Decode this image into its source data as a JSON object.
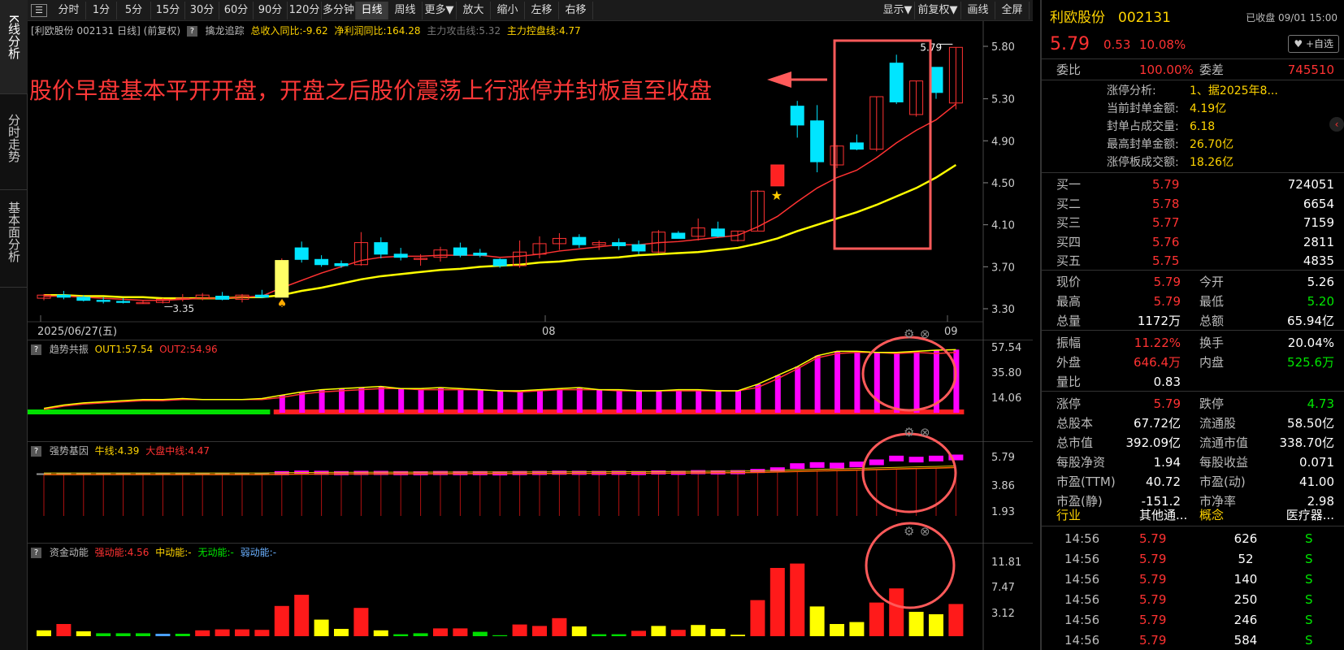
{
  "toolbar": {
    "items": [
      "分时",
      "1分",
      "5分",
      "15分",
      "30分",
      "60分",
      "90分",
      "120分",
      "多分钟",
      "日线",
      "周线",
      "更多▼",
      "放大",
      "缩小",
      "左移",
      "右移",
      "显示▼",
      "前复权▼",
      "画线",
      "全屏"
    ]
  },
  "left_tabs": [
    {
      "label": "K线分析"
    },
    {
      "label": "分时走势"
    },
    {
      "label": "基本面分析"
    }
  ],
  "kline": {
    "header": {
      "stock": "[利欧股份 002131 日线]",
      "fq": "(前复权)",
      "indicator": "擒龙追踪",
      "rev": "总收入同比:-9.62",
      "profit": "净利润同比:164.28",
      "attack": "主力攻击线:5.32",
      "control": "主力控盘线:4.77"
    },
    "y_ticks": [
      "5.80",
      "5.30",
      "4.90",
      "4.50",
      "4.10",
      "3.70",
      "3.30"
    ],
    "x_labels": [
      "2025/06/27(五)",
      "08",
      "09"
    ],
    "annotation": "股价早盘基本平开开盘，开盘之后股价震荡上行涨停并封板直至收盘",
    "low_label": "3.35",
    "high_label": "5.79",
    "colors": {
      "up": "#ff3232",
      "down": "#00e5ff",
      "ma1": "#ff3232",
      "ma2": "#ffff00",
      "highlight": "#ff5a5a"
    }
  },
  "chart_data": [
    {
      "type": "candlestick",
      "title": "利欧股份 002131 日线",
      "ohlc": [
        [
          3.4,
          3.44,
          3.38,
          3.43
        ],
        [
          3.43,
          3.47,
          3.39,
          3.41
        ],
        [
          3.41,
          3.43,
          3.37,
          3.38
        ],
        [
          3.38,
          3.41,
          3.35,
          3.37
        ],
        [
          3.37,
          3.4,
          3.35,
          3.36
        ],
        [
          3.36,
          3.38,
          3.35,
          3.36
        ],
        [
          3.36,
          3.4,
          3.35,
          3.39
        ],
        [
          3.39,
          3.44,
          3.37,
          3.4
        ],
        [
          3.4,
          3.45,
          3.38,
          3.43
        ],
        [
          3.42,
          3.46,
          3.38,
          3.39
        ],
        [
          3.39,
          3.44,
          3.36,
          3.43
        ],
        [
          3.43,
          3.48,
          3.4,
          3.41
        ],
        [
          3.41,
          3.78,
          3.41,
          3.76
        ],
        [
          3.88,
          3.94,
          3.74,
          3.77
        ],
        [
          3.77,
          3.81,
          3.7,
          3.72
        ],
        [
          3.73,
          3.76,
          3.69,
          3.71
        ],
        [
          3.72,
          4.03,
          3.71,
          3.93
        ],
        [
          3.93,
          3.98,
          3.78,
          3.82
        ],
        [
          3.82,
          3.88,
          3.76,
          3.79
        ],
        [
          3.77,
          3.82,
          3.71,
          3.78
        ],
        [
          3.79,
          3.89,
          3.75,
          3.86
        ],
        [
          3.88,
          3.93,
          3.79,
          3.81
        ],
        [
          3.83,
          3.87,
          3.79,
          3.81
        ],
        [
          3.77,
          3.78,
          3.69,
          3.71
        ],
        [
          3.71,
          3.95,
          3.69,
          3.84
        ],
        [
          3.82,
          3.99,
          3.78,
          3.92
        ],
        [
          3.92,
          4.02,
          3.86,
          3.97
        ],
        [
          3.98,
          4.01,
          3.88,
          3.91
        ],
        [
          3.91,
          3.95,
          3.86,
          3.93
        ],
        [
          3.93,
          3.97,
          3.86,
          3.9
        ],
        [
          3.91,
          3.95,
          3.82,
          3.85
        ],
        [
          3.84,
          4.05,
          3.83,
          4.03
        ],
        [
          4.02,
          4.04,
          3.97,
          3.97
        ],
        [
          3.99,
          4.16,
          3.95,
          4.07
        ],
        [
          4.06,
          4.13,
          3.98,
          3.99
        ],
        [
          3.95,
          4.04,
          3.94,
          4.04
        ],
        [
          4.04,
          4.43,
          4.04,
          4.42
        ],
        [
          4.47,
          4.67,
          4.47,
          4.67
        ],
        [
          5.23,
          5.28,
          4.93,
          5.05
        ],
        [
          5.09,
          5.24,
          4.6,
          4.7
        ],
        [
          4.67,
          4.86,
          4.64,
          4.85
        ],
        [
          4.88,
          4.96,
          4.81,
          4.82
        ],
        [
          4.82,
          5.32,
          4.8,
          5.32
        ],
        [
          5.64,
          5.72,
          5.25,
          5.27
        ],
        [
          5.15,
          5.47,
          5.13,
          5.47
        ],
        [
          5.6,
          5.6,
          5.3,
          5.36
        ],
        [
          5.26,
          5.79,
          5.2,
          5.79
        ]
      ],
      "ma1": [
        3.42,
        3.42,
        3.41,
        3.4,
        3.39,
        3.38,
        3.38,
        3.39,
        3.4,
        3.4,
        3.41,
        3.42,
        3.5,
        3.57,
        3.64,
        3.7,
        3.76,
        3.79,
        3.8,
        3.8,
        3.81,
        3.81,
        3.81,
        3.79,
        3.8,
        3.82,
        3.85,
        3.87,
        3.89,
        3.91,
        3.91,
        3.93,
        3.94,
        3.96,
        3.98,
        4.0,
        4.08,
        4.18,
        4.32,
        4.45,
        4.55,
        4.62,
        4.74,
        4.88,
        5.0,
        5.1,
        5.25
      ],
      "ma2": [
        3.43,
        3.43,
        3.42,
        3.42,
        3.41,
        3.41,
        3.4,
        3.4,
        3.4,
        3.4,
        3.41,
        3.41,
        3.43,
        3.47,
        3.5,
        3.54,
        3.58,
        3.61,
        3.63,
        3.65,
        3.67,
        3.68,
        3.7,
        3.71,
        3.72,
        3.74,
        3.75,
        3.77,
        3.78,
        3.79,
        3.81,
        3.82,
        3.83,
        3.84,
        3.86,
        3.88,
        3.92,
        3.97,
        4.04,
        4.1,
        4.16,
        4.22,
        4.29,
        4.37,
        4.45,
        4.55,
        4.67
      ],
      "ylim": [
        3.25,
        5.85
      ],
      "y_ticks": [
        3.3,
        3.7,
        4.1,
        4.5,
        4.9,
        5.3,
        5.8
      ]
    },
    {
      "type": "bar",
      "title": "趋势共振",
      "series": [
        {
          "name": "OUT1",
          "values": [
            4,
            7,
            9,
            10,
            11,
            12,
            12,
            13,
            12,
            12,
            12,
            13,
            16,
            19,
            21,
            22,
            23,
            24,
            22,
            22,
            23,
            22,
            21,
            20,
            20,
            21,
            22,
            23,
            21,
            21,
            20,
            20,
            21,
            21,
            20,
            20,
            26,
            34,
            42,
            52,
            56,
            56,
            55,
            55,
            56,
            57,
            57.54
          ]
        },
        {
          "name": "OUT2",
          "values": [
            3,
            6,
            8,
            9,
            10,
            11,
            11,
            12,
            12,
            12,
            12,
            12,
            14,
            17,
            19,
            20,
            21,
            22,
            22,
            21,
            21,
            21,
            21,
            20,
            19,
            20,
            21,
            21,
            21,
            20,
            20,
            20,
            20,
            20,
            20,
            20,
            23,
            31,
            40,
            50,
            54,
            55,
            55,
            54,
            55,
            54,
            54.96
          ]
        }
      ],
      "ticks": [
        "57.54",
        "35.80",
        "14.06"
      ],
      "ylim": [
        0,
        60
      ]
    },
    {
      "type": "bar",
      "title": "强势基因",
      "series": [
        {
          "name": "牛线",
          "values": [
            3.86,
            3.86,
            3.86,
            3.86,
            3.86,
            3.86,
            3.86,
            3.86,
            3.86,
            3.86,
            3.86,
            3.86,
            3.95,
            4.0,
            3.98,
            3.95,
            3.97,
            3.97,
            3.95,
            3.94,
            3.96,
            3.95,
            3.95,
            3.93,
            3.96,
            3.97,
            3.99,
            3.98,
            3.97,
            3.98,
            3.96,
            4.01,
            3.98,
            4.04,
            4.02,
            4.04,
            4.15,
            4.3,
            4.6,
            4.7,
            4.65,
            4.75,
            4.95,
            5.3,
            5.2,
            5.3,
            5.4
          ]
        },
        {
          "name": "大盘中线",
          "values": [
            3.82,
            3.82,
            3.82,
            3.82,
            3.82,
            3.82,
            3.82,
            3.82,
            3.82,
            3.82,
            3.82,
            3.82,
            3.84,
            3.86,
            3.87,
            3.88,
            3.88,
            3.89,
            3.89,
            3.89,
            3.9,
            3.9,
            3.91,
            3.91,
            3.91,
            3.92,
            3.92,
            3.93,
            3.93,
            3.94,
            3.94,
            3.95,
            3.96,
            3.97,
            3.98,
            3.99,
            4.02,
            4.06,
            4.11,
            4.15,
            4.19,
            4.23,
            4.28,
            4.33,
            4.38,
            4.42,
            4.47
          ]
        }
      ],
      "ticks": [
        "5.79",
        "3.86",
        "1.93"
      ],
      "ylim": [
        0,
        6
      ]
    },
    {
      "type": "bar",
      "title": "资金动能",
      "values": [
        1.2,
        2.5,
        1.0,
        0.6,
        0.6,
        0.6,
        0.5,
        0.5,
        1.2,
        1.4,
        1.4,
        1.3,
        6.2,
        8.5,
        3.4,
        1.5,
        5.8,
        1.2,
        0.4,
        0.6,
        1.6,
        1.6,
        0.9,
        0.2,
        2.4,
        2.1,
        3.7,
        2.0,
        0.4,
        0.4,
        1.1,
        2.1,
        1.3,
        2.3,
        1.5,
        0.3,
        7.4,
        14.0,
        14.9,
        6.1,
        2.5,
        2.9,
        6.9,
        9.8,
        5.0,
        4.5,
        6.6
      ],
      "colors": [
        "y",
        "r",
        "y",
        "g",
        "g",
        "g",
        "b",
        "g",
        "r",
        "r",
        "r",
        "r",
        "r",
        "r",
        "y",
        "y",
        "r",
        "y",
        "g",
        "g",
        "r",
        "r",
        "g",
        "g",
        "r",
        "r",
        "r",
        "y",
        "g",
        "g",
        "r",
        "y",
        "r",
        "y",
        "y",
        "y",
        "r",
        "r",
        "r",
        "y",
        "y",
        "y",
        "r",
        "r",
        "y",
        "y",
        "r"
      ],
      "ticks": [
        "11.81",
        "7.47",
        "3.12"
      ],
      "ylim": [
        0,
        15.5
      ]
    }
  ],
  "panels": {
    "p2": {
      "name": "趋势共振",
      "out1": "OUT1:57.54",
      "out2": "OUT2:54.96",
      "ticks": [
        "57.54",
        "35.80",
        "14.06"
      ]
    },
    "p3": {
      "name": "强势基因",
      "bull": "牛线:4.39",
      "mid": "大盘中线:4.47",
      "ticks": [
        "5.79",
        "3.86",
        "1.93"
      ]
    },
    "p4": {
      "name": "资金动能",
      "strong": "强动能:4.56",
      "mid": "中动能:-",
      "none": "无动能:-",
      "weak": "弱动能:-",
      "ticks": [
        "11.81",
        "7.47",
        "3.12"
      ]
    }
  },
  "quote": {
    "name": "利欧股份",
    "code": "002131",
    "status": "已收盘 09/01 15:00",
    "price": "5.79",
    "change": "0.53",
    "pct": "10.08%",
    "add_button": "+自选",
    "wb_label": "委比",
    "wb": "100.00%",
    "wc_label": "委差",
    "wc": "745510",
    "limit_analysis": [
      [
        "涨停分析:",
        "1、据2025年8..."
      ],
      [
        "当前封单金额:",
        "4.19亿"
      ],
      [
        "封单占成交量:",
        "6.18"
      ],
      [
        "最高封单金额:",
        "26.70亿"
      ],
      [
        "涨停板成交额:",
        "18.26亿"
      ]
    ],
    "bids": [
      [
        "买一",
        "5.79",
        "724051"
      ],
      [
        "买二",
        "5.78",
        "6654"
      ],
      [
        "买三",
        "5.77",
        "7159"
      ],
      [
        "买四",
        "5.76",
        "2811"
      ],
      [
        "买五",
        "5.75",
        "4835"
      ]
    ],
    "stats": [
      [
        "现价",
        "5.79",
        "今开",
        "5.26"
      ],
      [
        "最高",
        "5.79",
        "最低",
        "5.20"
      ],
      [
        "总量",
        "1172万",
        "总额",
        "65.94亿"
      ],
      [
        "振幅",
        "11.22%",
        "换手",
        "20.04%"
      ],
      [
        "外盘",
        "646.4万",
        "内盘",
        "525.6万"
      ],
      [
        "量比",
        "0.83",
        "",
        ""
      ],
      [
        "涨停",
        "5.79",
        "跌停",
        "4.73"
      ],
      [
        "总股本",
        "67.72亿",
        "流通股",
        "58.50亿"
      ],
      [
        "总市值",
        "392.09亿",
        "流通市值",
        "338.70亿"
      ],
      [
        "每股净资",
        "1.94",
        "每股收益",
        "0.071"
      ],
      [
        "市盈(TTM)",
        "40.72",
        "市盈(动)",
        "41.00"
      ],
      [
        "市盈(静)",
        "-151.2",
        "市净率",
        "2.98"
      ]
    ],
    "industry": [
      "行业",
      "其他通...",
      "概念",
      "医疗器..."
    ],
    "trades": [
      [
        "14:56",
        "5.79",
        "626",
        "S"
      ],
      [
        "14:56",
        "5.79",
        "52",
        "S"
      ],
      [
        "14:56",
        "5.79",
        "140",
        "S"
      ],
      [
        "14:56",
        "5.79",
        "250",
        "S"
      ],
      [
        "14:56",
        "5.79",
        "246",
        "S"
      ],
      [
        "14:56",
        "5.79",
        "584",
        "S"
      ]
    ]
  }
}
